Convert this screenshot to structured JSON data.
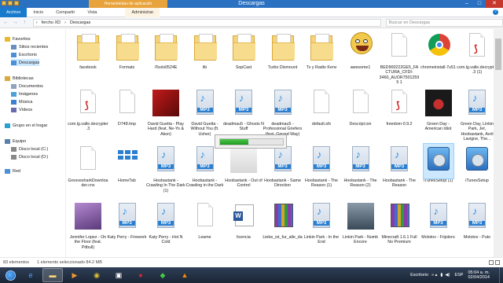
{
  "window": {
    "title": "Descargas",
    "context_tab": "Herramientas de aplicación"
  },
  "ribbon": {
    "tabs": [
      "Archivo",
      "Inicio",
      "Compartir",
      "Vista",
      "Administrar"
    ]
  },
  "address": {
    "crumbs": [
      "fercho XD",
      "Descargas"
    ],
    "search_placeholder": "Buscar en Descargas"
  },
  "sidebar": {
    "items": [
      {
        "label": "Favoritos",
        "icon": "star-icon"
      },
      {
        "label": "Sitios recientes",
        "icon": "recent-places-icon"
      },
      {
        "label": "Escritorio",
        "icon": "desktop-icon"
      },
      {
        "label": "Descargas",
        "icon": "downloads-icon"
      },
      {
        "label": "Bibliotecas",
        "icon": "libraries-icon"
      },
      {
        "label": "Documentos",
        "icon": "documents-icon"
      },
      {
        "label": "Imágenes",
        "icon": "pictures-icon"
      },
      {
        "label": "Música",
        "icon": "music-icon"
      },
      {
        "label": "Vídeos",
        "icon": "videos-icon"
      },
      {
        "label": "Grupo en el hogar",
        "icon": "homegroup-icon"
      },
      {
        "label": "Equipo",
        "icon": "computer-icon"
      },
      {
        "label": "Disco local (C:)",
        "icon": "drive-icon"
      },
      {
        "label": "Disco local (D:)",
        "icon": "drive-icon"
      },
      {
        "label": "Red",
        "icon": "network-icon"
      }
    ]
  },
  "files": [
    {
      "label": "facebook",
      "kind": "folder"
    },
    {
      "label": "Formats",
      "kind": "folder"
    },
    {
      "label": "iTools0524E",
      "kind": "folder"
    },
    {
      "label": "lib",
      "kind": "folder"
    },
    {
      "label": "SopCast",
      "kind": "folder"
    },
    {
      "label": "Turbo Dismount",
      "kind": "folder"
    },
    {
      "label": "Tv y Radio Kenv",
      "kind": "folder"
    },
    {
      "label": "awesome1",
      "kind": "smiley"
    },
    {
      "label": "BED900222GE5_FACTURA_CFDI-3460_AUOR75012595 1",
      "kind": "doc"
    },
    {
      "label": "chromeinstall-7u51",
      "kind": "chrome"
    },
    {
      "label": "com.lg.valle.decrypter.3 (1)",
      "kind": "pdf"
    },
    {
      "label": "com.lg.valle.decrypter.3",
      "kind": "pdf"
    },
    {
      "label": "D748.tmp",
      "kind": "doc"
    },
    {
      "label": "David Guetta - Play Hard (feat. Ne-Yo & Akon)",
      "kind": "photo-red"
    },
    {
      "label": "David Guetta - Without You (ft. Usher)",
      "kind": "mp3"
    },
    {
      "label": "deadmau5 - Ghosts N Stuff",
      "kind": "mp3"
    },
    {
      "label": "deadmau5 - Professional Griefers (feat. Gerard Way)",
      "kind": "mp3"
    },
    {
      "label": "default.sfx",
      "kind": "doc"
    },
    {
      "label": "Descript.ion",
      "kind": "doc"
    },
    {
      "label": "freedom-0.9.2",
      "kind": "pdf"
    },
    {
      "label": "Green Day - American Idiot",
      "kind": "photo-dark"
    },
    {
      "label": "Green Day, Linkin Park, Jet, Hoobastank, Avril Lavigne, The...",
      "kind": "mp3"
    },
    {
      "label": "GroovesharkDownloader.cnx",
      "kind": "doc"
    },
    {
      "label": "HomeTab",
      "kind": "grid"
    },
    {
      "label": "Hoobastank - Crawling In The Dark (1)",
      "kind": "mp3"
    },
    {
      "label": "Hoobastank - Crawling in the Dark",
      "kind": "mp3"
    },
    {
      "label": "Hoobastank - Out of Control",
      "kind": "photo-light"
    },
    {
      "label": "Hoobastank - Same Direction",
      "kind": "mp3"
    },
    {
      "label": "Hoobastank - The Reason (1)",
      "kind": "mp3"
    },
    {
      "label": "Hoobastank - The Reason (2)",
      "kind": "mp3"
    },
    {
      "label": "Hoobastank - The Reason",
      "kind": "mp3"
    },
    {
      "label": "iTunesSetup (1)",
      "kind": "setup"
    },
    {
      "label": "iTunesSetup",
      "kind": "setup"
    },
    {
      "label": "Jennifer Lopez - On the Floor (feat. Pitbull)",
      "kind": "photo-purple"
    },
    {
      "label": "Katy Perry - Firework",
      "kind": "mp3"
    },
    {
      "label": "Katy Perry - Hot N Cold",
      "kind": "mp3"
    },
    {
      "label": "Leame",
      "kind": "doc"
    },
    {
      "label": "licencia",
      "kind": "word"
    },
    {
      "label": "Liebe_ist_fur_alle_da",
      "kind": "rar"
    },
    {
      "label": "Linkin Park - In the End",
      "kind": "mp3"
    },
    {
      "label": "Linkin Park - Numb Encore",
      "kind": "photo-gray"
    },
    {
      "label": "Minecraft 1.6.1 Full No Premium",
      "kind": "rar"
    },
    {
      "label": "Molotov - Frijolero",
      "kind": "mp3"
    },
    {
      "label": "Molotov - Puto",
      "kind": "mp3"
    }
  ],
  "selected_file": "iTunesSetup (1)",
  "mp3_badge": "MP3",
  "progress": {
    "value": 0.45
  },
  "status": {
    "count": "83 elementos",
    "selection": "1 elemento seleccionado  84.2 MB"
  },
  "taskbar": {
    "desktop_label": "Escritorio",
    "lang": "ESP",
    "time": "05:04 a. m.",
    "date": "02/04/2014"
  }
}
